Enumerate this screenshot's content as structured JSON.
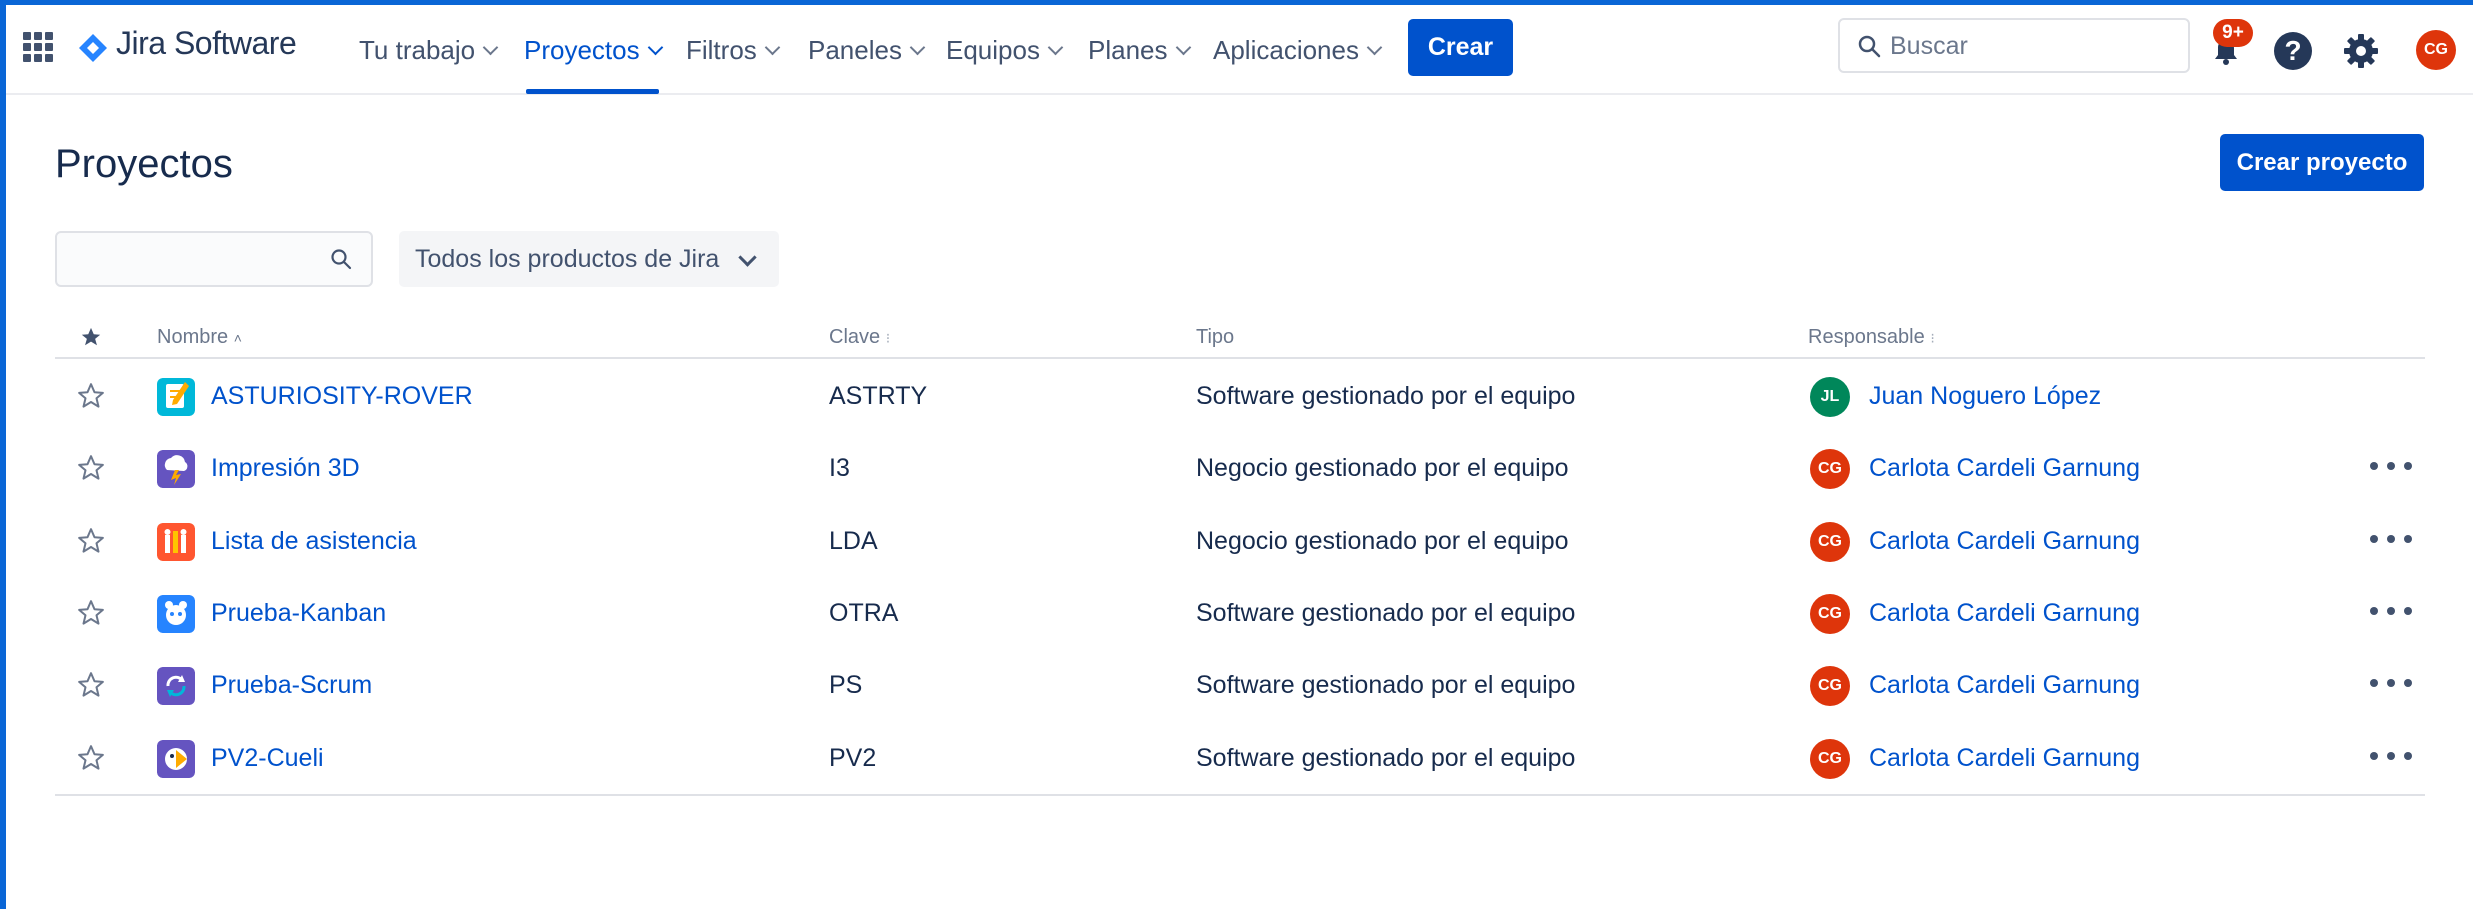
{
  "header": {
    "app_name": "Jira Software",
    "nav": [
      {
        "label": "Tu trabajo",
        "active": false
      },
      {
        "label": "Proyectos",
        "active": true
      },
      {
        "label": "Filtros",
        "active": false
      },
      {
        "label": "Paneles",
        "active": false
      },
      {
        "label": "Equipos",
        "active": false
      },
      {
        "label": "Planes",
        "active": false
      },
      {
        "label": "Aplicaciones",
        "active": false
      }
    ],
    "create_label": "Crear",
    "search_placeholder": "Buscar",
    "notifications_badge": "9+",
    "help_glyph": "?",
    "user_initials": "CG"
  },
  "page": {
    "title": "Proyectos",
    "create_project_label": "Crear proyecto",
    "filter_search_value": "",
    "product_filter": "Todos los productos de Jira"
  },
  "table": {
    "columns": {
      "star": "star-icon",
      "name": "Nombre",
      "key": "Clave",
      "type": "Tipo",
      "lead": "Responsable"
    },
    "rows": [
      {
        "name": "ASTURIOSITY-ROVER",
        "key": "ASTRTY",
        "type": "Software gestionado por el equipo",
        "lead_initials": "JL",
        "lead_name": "Juan Noguero López",
        "lead_color": "#00875A",
        "icon_color": "#00B8D9",
        "icon": "notepad-pencil-icon",
        "has_menu": false
      },
      {
        "name": "Impresión 3D",
        "key": "I3",
        "type": "Negocio gestionado por el equipo",
        "lead_initials": "CG",
        "lead_name": "Carlota Cardeli Garnung",
        "lead_color": "#DE350B",
        "icon_color": "#6554C0",
        "icon": "cloud-storm-icon",
        "has_menu": true
      },
      {
        "name": "Lista de asistencia",
        "key": "LDA",
        "type": "Negocio gestionado por el equipo",
        "lead_initials": "CG",
        "lead_name": "Carlota Cardeli Garnung",
        "lead_color": "#DE350B",
        "icon_color": "#FF5630",
        "icon": "people-icon",
        "has_menu": true
      },
      {
        "name": "Prueba-Kanban",
        "key": "OTRA",
        "type": "Software gestionado por el equipo",
        "lead_initials": "CG",
        "lead_name": "Carlota Cardeli Garnung",
        "lead_color": "#DE350B",
        "icon_color": "#2684FF",
        "icon": "creature-icon",
        "has_menu": true
      },
      {
        "name": "Prueba-Scrum",
        "key": "PS",
        "type": "Software gestionado por el equipo",
        "lead_initials": "CG",
        "lead_name": "Carlota Cardeli Garnung",
        "lead_color": "#DE350B",
        "icon_color": "#6554C0",
        "icon": "refresh-icon",
        "has_menu": true
      },
      {
        "name": "PV2-Cueli",
        "key": "PV2",
        "type": "Software gestionado por el equipo",
        "lead_initials": "CG",
        "lead_name": "Carlota Cardeli Garnung",
        "lead_color": "#DE350B",
        "icon_color": "#6554C0",
        "icon": "bird-icon",
        "has_menu": true
      }
    ]
  },
  "colors": {
    "accent": "#0052CC",
    "frame": "#0A66D6",
    "badge": "#DE350B"
  }
}
